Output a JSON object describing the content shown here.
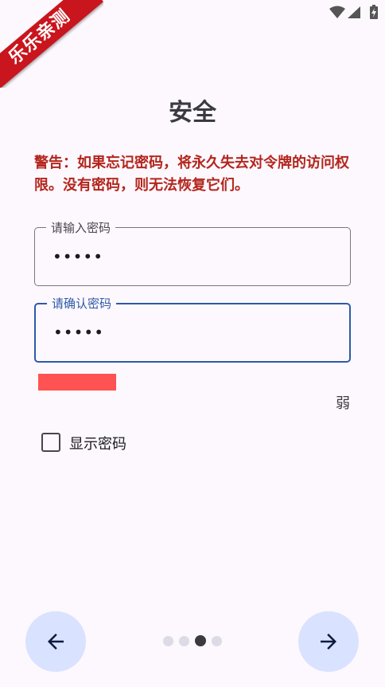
{
  "ribbon": {
    "text": "乐乐亲测"
  },
  "page": {
    "title": "安全",
    "warning": "警告：如果忘记密码，将永久失去对令牌的访问权限。没有密码，则无法恢复它们。"
  },
  "fields": [
    {
      "label": "请输入密码",
      "value": "•••••",
      "focused": false
    },
    {
      "label": "请确认密码",
      "value": "•••••",
      "focused": true
    }
  ],
  "strength": {
    "label": "弱",
    "level": 0.2,
    "color": "#ff5252"
  },
  "show_password": {
    "label": "显示密码",
    "checked": false
  },
  "pager": {
    "count": 4,
    "current": 3
  },
  "colors": {
    "accent": "#2e5aa8",
    "warning": "#b3261e",
    "nav_button_bg": "#d9e2ff",
    "background": "#fdf8fd"
  },
  "icons": {
    "back": "arrow-left-icon",
    "next": "arrow-right-icon",
    "status": [
      "keyboard-icon",
      "wifi-icon",
      "signal-icon",
      "battery-charging-icon"
    ]
  }
}
